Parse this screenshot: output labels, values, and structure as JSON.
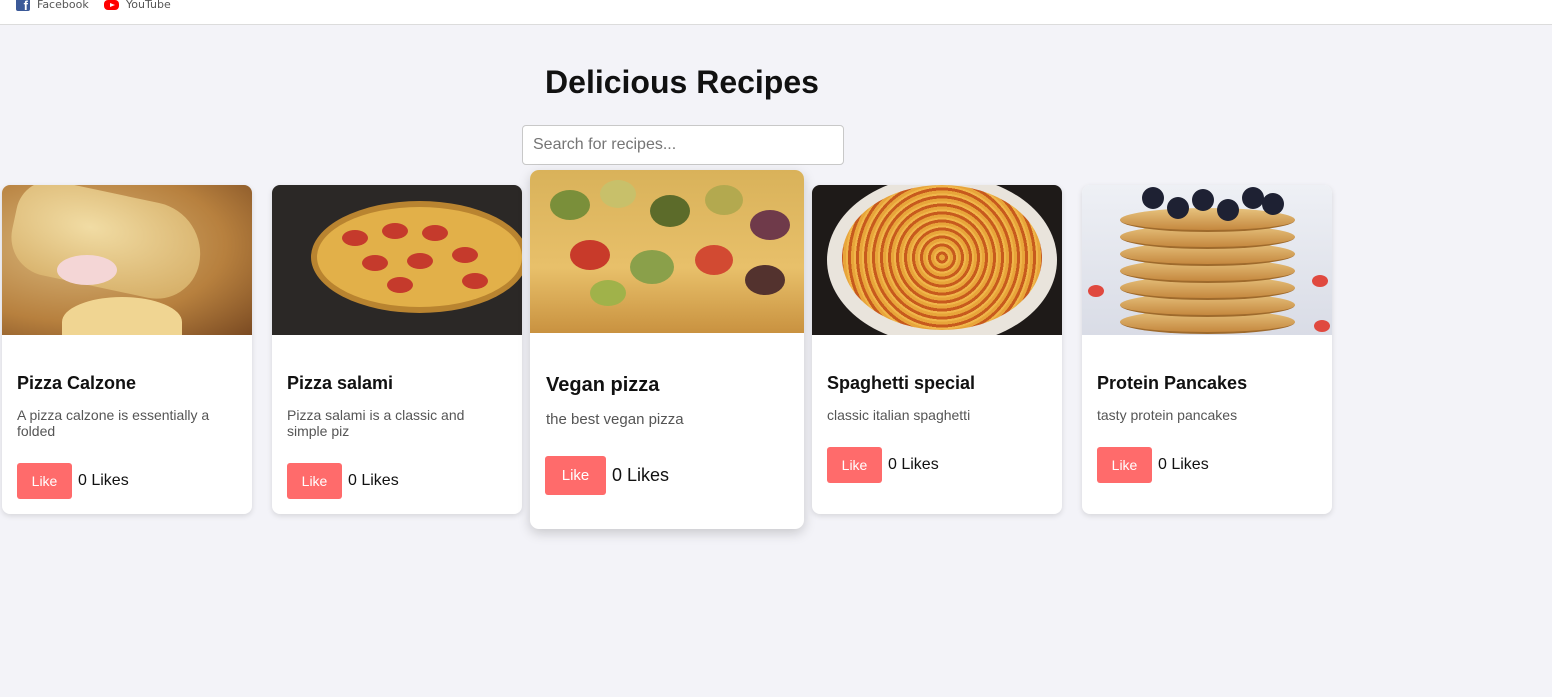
{
  "bookmarks": [
    {
      "label": "Facebook",
      "icon": "facebook-icon"
    },
    {
      "label": "YouTube",
      "icon": "youtube-icon"
    }
  ],
  "page": {
    "title": "Delicious Recipes",
    "search_placeholder": "Search for recipes...",
    "search_value": ""
  },
  "colors": {
    "background": "#f3f3f8",
    "like_button": "#ff6b6b"
  },
  "recipes": [
    {
      "title": "Pizza Calzone",
      "description": "A pizza calzone is essentially a folded",
      "like_label": "Like",
      "likes": "0 Likes",
      "image": "calzone-image"
    },
    {
      "title": "Pizza salami",
      "description": "Pizza salami is a classic and simple piz",
      "like_label": "Like",
      "likes": "0 Likes",
      "image": "pizza-salami-image"
    },
    {
      "title": "Vegan pizza",
      "description": "the best vegan pizza",
      "like_label": "Like",
      "likes": "0 Likes",
      "image": "vegan-pizza-image"
    },
    {
      "title": "Spaghetti special",
      "description": "classic italian spaghetti",
      "like_label": "Like",
      "likes": "0 Likes",
      "image": "spaghetti-image"
    },
    {
      "title": "Protein Pancakes",
      "description": "tasty protein pancakes",
      "like_label": "Like",
      "likes": "0 Likes",
      "image": "pancakes-image"
    }
  ]
}
